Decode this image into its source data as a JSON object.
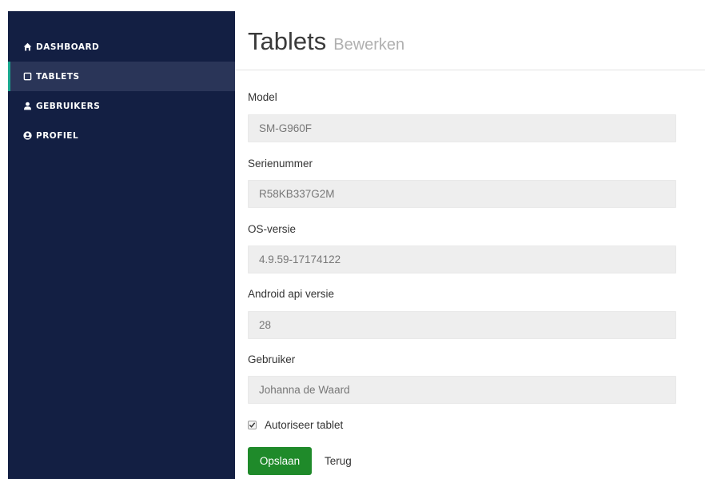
{
  "sidebar": {
    "items": [
      {
        "label": "DASHBOARD",
        "icon": "home-icon",
        "active": false
      },
      {
        "label": "TABLETS",
        "icon": "tablet-icon",
        "active": true
      },
      {
        "label": "GEBRUIKERS",
        "icon": "user-icon",
        "active": false
      },
      {
        "label": "PROFIEL",
        "icon": "user-circle-icon",
        "active": false
      }
    ]
  },
  "header": {
    "title": "Tablets",
    "subtitle": "Bewerken"
  },
  "form": {
    "fields": [
      {
        "label": "Model",
        "value": "SM-G960F"
      },
      {
        "label": "Serienummer",
        "value": "R58KB337G2M"
      },
      {
        "label": "OS-versie",
        "value": "4.9.59-17174122"
      },
      {
        "label": "Android api versie",
        "value": "28"
      },
      {
        "label": "Gebruiker",
        "value": "Johanna de Waard"
      }
    ],
    "authorize_label": "Autoriseer tablet",
    "authorize_checked": true,
    "save_label": "Opslaan",
    "back_label": "Terug"
  },
  "colors": {
    "sidebar_bg": "#131f43",
    "sidebar_active_bg": "#2a3558",
    "active_accent": "#1aa88f",
    "save_button": "#1f8a2a",
    "input_bg": "#eeeeee"
  }
}
